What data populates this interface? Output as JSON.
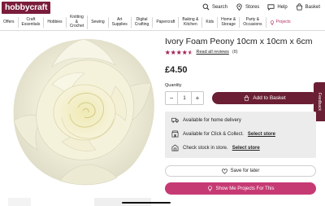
{
  "brand": {
    "logo_text": "hobbycraft",
    "color": "#7a1d3a"
  },
  "header": {
    "search_label": "Search",
    "stores_label": "Stores",
    "help_label": "Help",
    "basket_label": "Basket"
  },
  "nav": {
    "items": [
      {
        "label": "Offers"
      },
      {
        "label": "Craft\nEssentials"
      },
      {
        "label": "Hobbies"
      },
      {
        "label": "Knitting\n&\nCrochet"
      },
      {
        "label": "Sewing"
      },
      {
        "label": "Art\nSupplies"
      },
      {
        "label": "Digital\nCrafting"
      },
      {
        "label": "Papercraft"
      },
      {
        "label": "Baking &\nKitchen"
      },
      {
        "label": "Kids"
      },
      {
        "label": "Home &\nStorage"
      },
      {
        "label": "Party &\nOccasions"
      },
      {
        "label": "Projects",
        "icon": "bulb-icon",
        "accent": "#b32c64"
      }
    ]
  },
  "product": {
    "title": "Ivory Foam Peony 10cm x 10cm x 6cm",
    "rating": 4.5,
    "reviews_link": "Read all reviews",
    "reviews_count": "(8)",
    "price": "£4.50",
    "quantity_label": "Quantity",
    "quantity_value": "1"
  },
  "actions": {
    "add_to_basket": "Add to Basket",
    "feedback": "Feedback",
    "save_for_later": "Save for later",
    "show_projects": "Show Me Projects For This"
  },
  "delivery": {
    "home": "Available for home delivery",
    "click_collect": "Available for Click & Collect.",
    "click_collect_link": "Select store",
    "stock_check": "Check stock in store.",
    "stock_link": "Select store"
  },
  "colors": {
    "primary": "#6b1f34",
    "accent_pink": "#c63a74",
    "star": "#a6295a"
  }
}
